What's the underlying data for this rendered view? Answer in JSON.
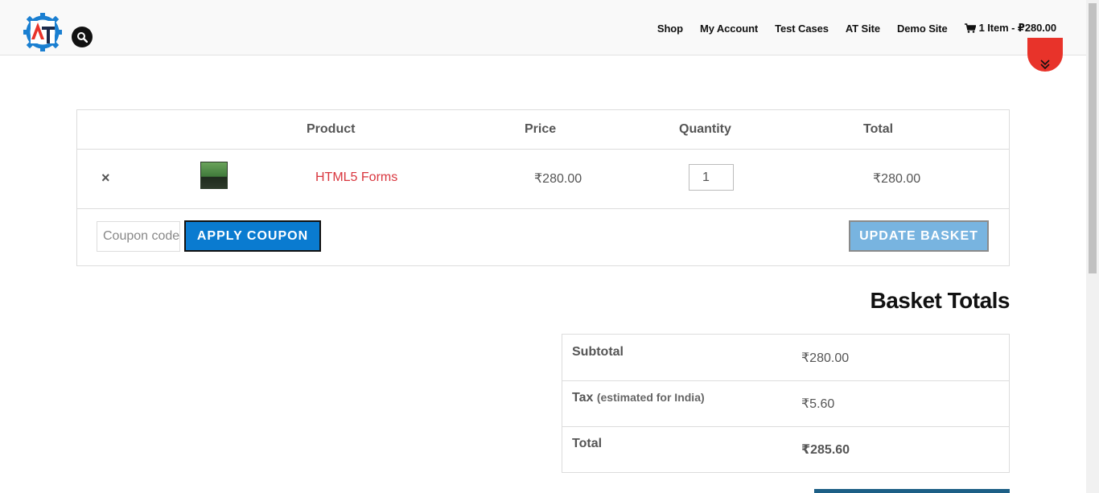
{
  "header": {
    "logo_letters": "AT",
    "nav": [
      {
        "label": "Shop"
      },
      {
        "label": "My Account"
      },
      {
        "label": "Test Cases"
      },
      {
        "label": "AT Site"
      },
      {
        "label": "Demo Site"
      }
    ],
    "cart_link": "1 Item - ₽280.00"
  },
  "cart": {
    "columns": {
      "product": "Product",
      "price": "Price",
      "quantity": "Quantity",
      "total": "Total"
    },
    "items": [
      {
        "remove": "×",
        "name": "HTML5 Forms",
        "price": "₹280.00",
        "quantity": "1",
        "total": "₹280.00"
      }
    ],
    "coupon_placeholder": "Coupon code",
    "apply_coupon_label": "APPLY COUPON",
    "update_basket_label": "UPDATE BASKET"
  },
  "totals": {
    "title": "Basket Totals",
    "subtotal_label": "Subtotal",
    "subtotal_value": "₹280.00",
    "tax_label": "Tax",
    "tax_note": "(estimated for India)",
    "tax_value": "₹5.60",
    "total_label": "Total",
    "total_value": "₹285.60"
  },
  "colors": {
    "accent_blue": "#0a7bd0",
    "link_red": "#d9363e",
    "scroll_red": "#e8332a"
  }
}
